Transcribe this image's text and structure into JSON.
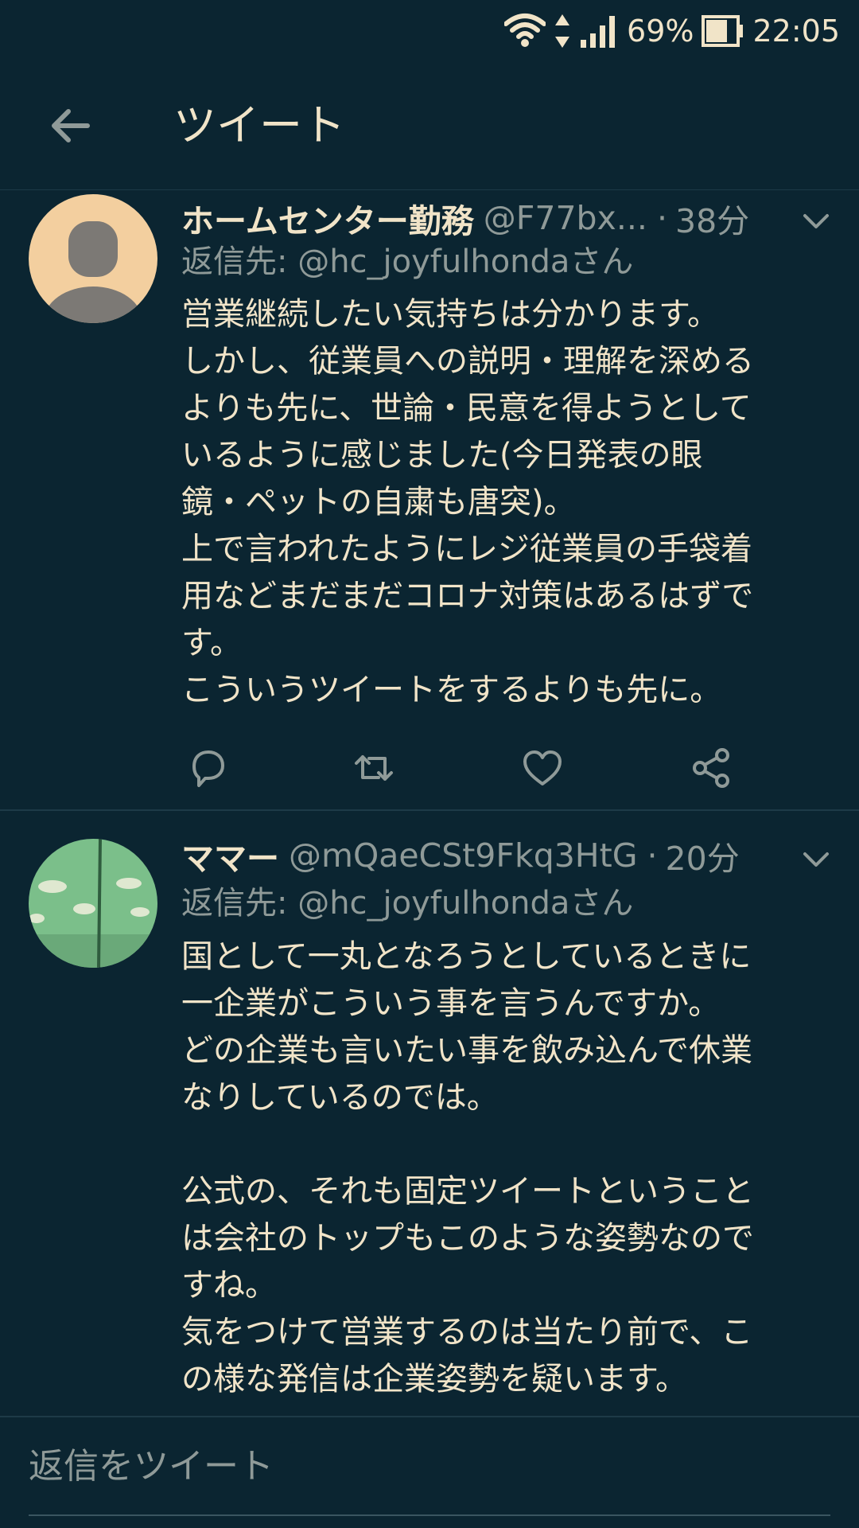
{
  "status_bar": {
    "battery": "69%",
    "time": "22:05"
  },
  "app_bar": {
    "title": "ツイート"
  },
  "tweets": [
    {
      "display_name": "ホームセンター勤務",
      "handle": "@F77bx...",
      "separator": "·",
      "time": "38分",
      "reply_prefix": "返信先: ",
      "reply_handle": "@hc_joyfulhondaさん",
      "lines": [
        "営業継続したい気持ちは分かります。",
        "しかし、従業員への説明・理解を深める",
        "よりも先に、世論・民意を得ようとして",
        "いるように感じました(今日発表の眼",
        "鏡・ペットの自粛も唐突)。",
        "上で言われたようにレジ従業員の手袋着",
        "用などまだまだコロナ対策はあるはずで",
        "す。",
        "こういうツイートをするよりも先に。"
      ],
      "avatar_icon": "default-profile-icon"
    },
    {
      "display_name": "ママー",
      "handle": "@mQaeCSt9Fkq3HtG",
      "separator": "·",
      "time": "20分",
      "reply_prefix": "返信先: ",
      "reply_handle": "@hc_joyfulhondaさん",
      "lines": [
        "国として一丸となろうとしているときに",
        "一企業がこういう事を言うんですか。",
        "どの企業も言いたい事を飲み込んで休業",
        "なりしているのでは。",
        "",
        "公式の、それも固定ツイートということ",
        "は会社のトップもこのような姿勢なので",
        "すね。",
        "気をつけて営業するのは当たり前で、こ",
        "の様な発信は企業姿勢を疑います。"
      ],
      "avatar_icon": "green-cloud-avatar"
    }
  ],
  "compose": {
    "placeholder": "返信をツイート"
  },
  "colors": {
    "background": "#0b2531",
    "text": "#f1e4c8",
    "muted": "#8f9a98",
    "divider": "#1d3a47"
  }
}
